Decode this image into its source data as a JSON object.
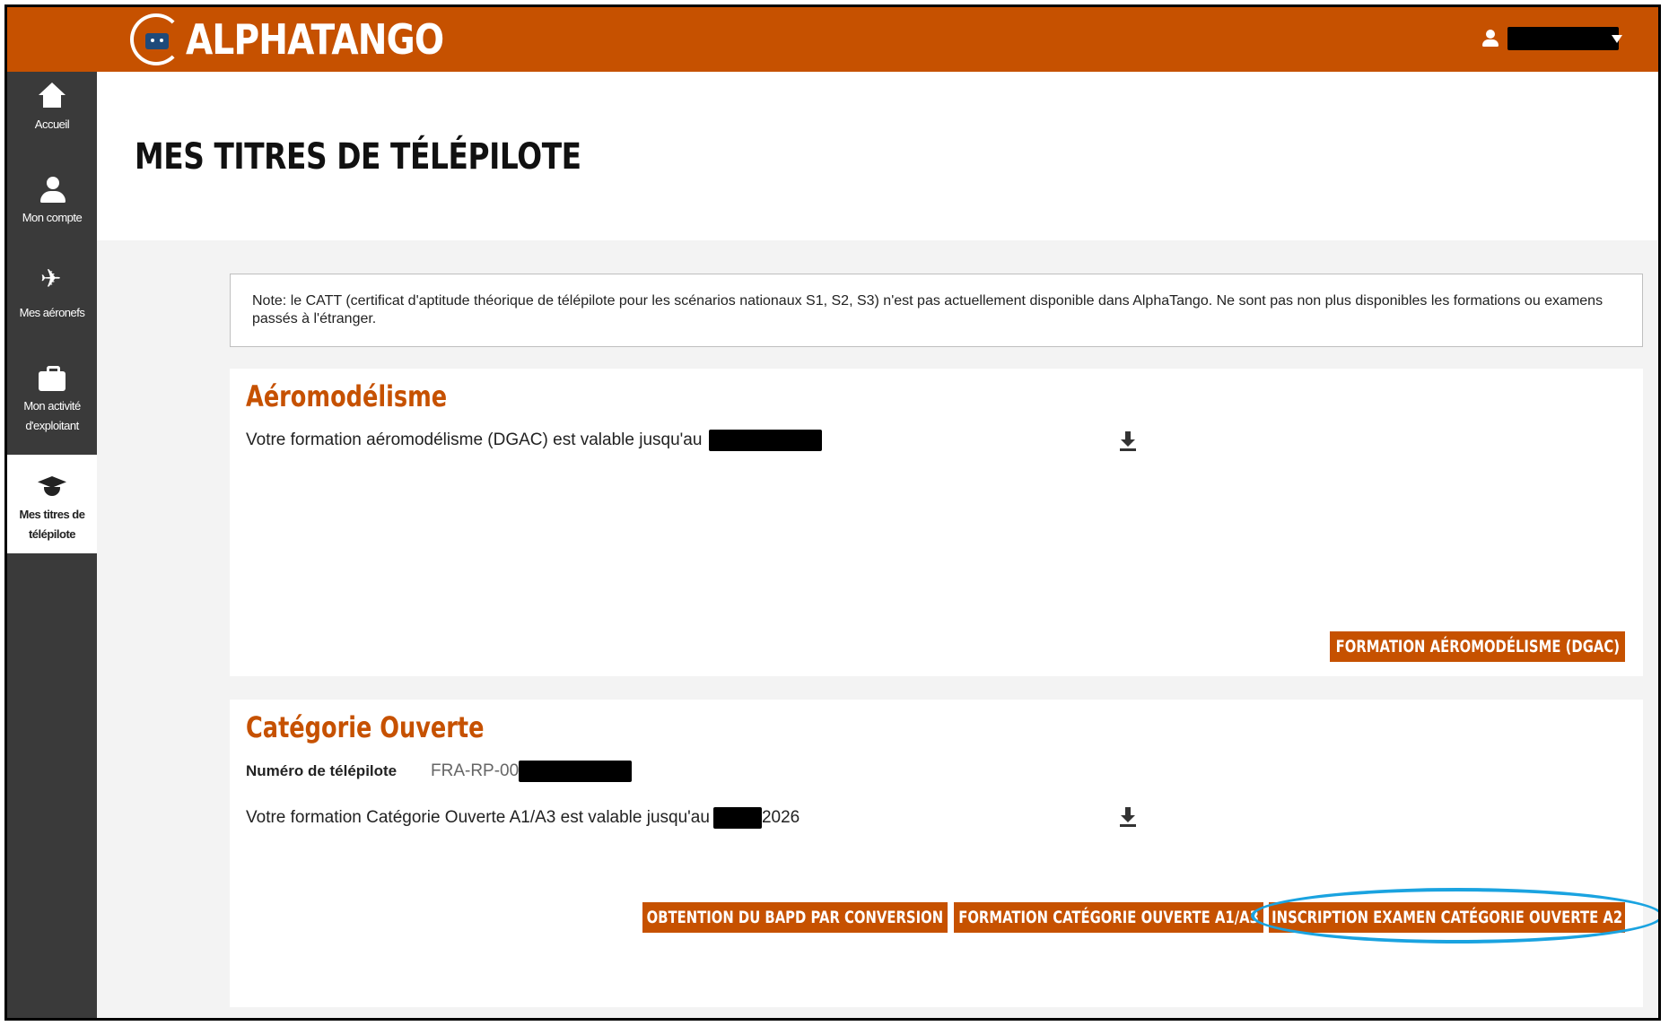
{
  "app": {
    "logo_text": "ALPHATANGO"
  },
  "sidebar": {
    "items": [
      {
        "label": "Accueil",
        "icon": "home-icon"
      },
      {
        "label": "Mon compte",
        "icon": "person-icon"
      },
      {
        "label": "Mes aéronefs",
        "icon": "plane-icon"
      },
      {
        "label": "Mon activité d'exploitant",
        "icon": "briefcase-icon"
      },
      {
        "label": "Mes titres de télépilote",
        "icon": "graduation-cap-icon",
        "active": true
      }
    ]
  },
  "page": {
    "title": "MES TITRES DE TÉLÉPILOTE"
  },
  "note": {
    "text": "Note: le CATT (certificat d'aptitude théorique de télépilote pour les scénarios nationaux S1, S2, S3) n'est pas actuellement disponible dans AlphaTango. Ne sont pas non plus disponibles les formations ou examens passés à l'étranger."
  },
  "aeromodelisme": {
    "title": "Aéromodélisme",
    "validity_text": "Votre formation aéromodélisme (DGAC) est valable jusqu'au",
    "button": "FORMATION AÉROMODÉLISME (DGAC)"
  },
  "categorie_ouverte": {
    "title": "Catégorie Ouverte",
    "pilot_number_label": "Numéro de télépilote",
    "pilot_number_prefix": "FRA-RP-00",
    "validity_text": "Votre formation Catégorie Ouverte A1/A3 est valable jusqu'au",
    "validity_year": "2026",
    "buttons": [
      "OBTENTION DU BAPD PAR CONVERSION",
      "FORMATION CATÉGORIE OUVERTE A1/A3",
      "INSCRIPTION EXAMEN CATÉGORIE OUVERTE A2"
    ]
  },
  "colors": {
    "brand": "#c65100",
    "sidebar": "#3a3a3a",
    "highlight": "#1aa3e0"
  }
}
